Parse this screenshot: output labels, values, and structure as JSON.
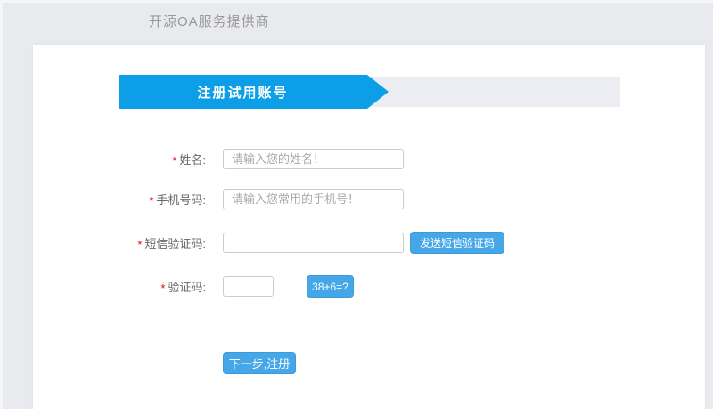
{
  "header": {
    "brand": "开源OA服务提供商"
  },
  "banner": {
    "title": "注册试用账号"
  },
  "form": {
    "fields": [
      {
        "required": "*",
        "label": "姓名:",
        "placeholder": "请输入您的姓名！"
      },
      {
        "required": "*",
        "label": "手机号码:",
        "placeholder": "请输入您常用的手机号！"
      },
      {
        "required": "*",
        "label": "短信验证码:",
        "placeholder": ""
      },
      {
        "required": "*",
        "label": "验证码:",
        "placeholder": ""
      }
    ],
    "sms_button_label": "发送短信验证码",
    "captcha_button_label": "38+6=?",
    "submit_label": "下一步,注册"
  },
  "colors": {
    "page_background": "#e9eaee",
    "banner_blue": "#0c9fe8",
    "banner_track_gray": "#ebedf2",
    "button_blue": "#45a7e8",
    "required_red": "#e60012",
    "label_gray": "#666666",
    "brand_gray": "#999999"
  }
}
